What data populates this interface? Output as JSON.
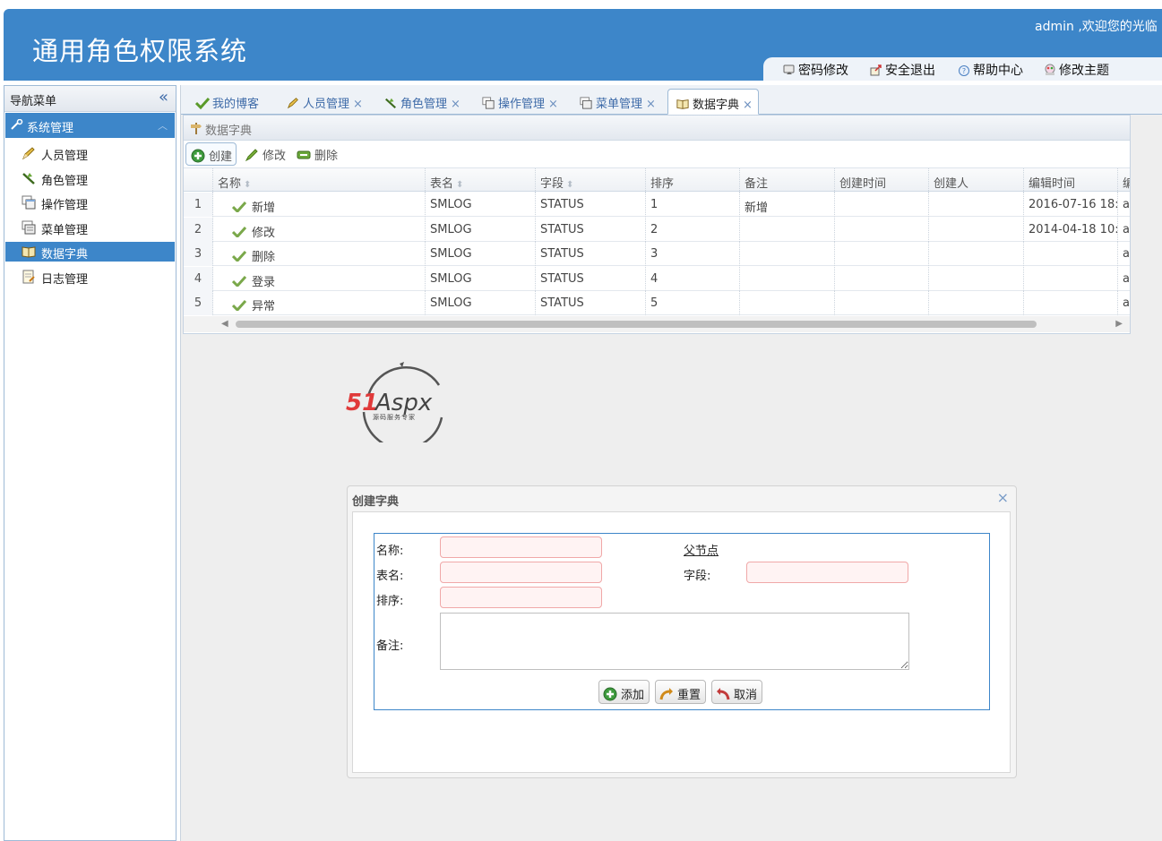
{
  "header": {
    "title": "通用角色权限系统",
    "welcome": "admin ,欢迎您的光临",
    "links": [
      "密码修改",
      "安全退出",
      "帮助中心",
      "修改主题"
    ]
  },
  "sidebar": {
    "title": "导航菜单",
    "collapse": "«",
    "group": "系统管理",
    "items": [
      "人员管理",
      "角色管理",
      "操作管理",
      "菜单管理",
      "数据字典",
      "日志管理"
    ],
    "active_index": 4
  },
  "tabs": [
    {
      "label": "我的博客",
      "closable": false
    },
    {
      "label": "人员管理",
      "closable": true
    },
    {
      "label": "角色管理",
      "closable": true
    },
    {
      "label": "操作管理",
      "closable": true
    },
    {
      "label": "菜单管理",
      "closable": true
    },
    {
      "label": "数据字典",
      "closable": true,
      "active": true
    }
  ],
  "tab_close": "×",
  "panel": {
    "title": "数据字典",
    "toolbar": {
      "create": "创建",
      "edit": "修改",
      "delete": "删除"
    }
  },
  "grid": {
    "columns": [
      "名称",
      "表名",
      "字段",
      "排序",
      "备注",
      "创建时间",
      "创建人",
      "编辑时间",
      "编"
    ],
    "rows": [
      {
        "no": "1",
        "name": "新增",
        "table": "SMLOG",
        "field": "STATUS",
        "order": "1",
        "remark": "新增",
        "created": "",
        "creator": "",
        "edited": "2016-07-16 18:",
        "last": "a"
      },
      {
        "no": "2",
        "name": "修改",
        "table": "SMLOG",
        "field": "STATUS",
        "order": "2",
        "remark": "",
        "created": "",
        "creator": "",
        "edited": "2014-04-18 10:",
        "last": "a"
      },
      {
        "no": "3",
        "name": "删除",
        "table": "SMLOG",
        "field": "STATUS",
        "order": "3",
        "remark": "",
        "created": "",
        "creator": "",
        "edited": "",
        "last": "a"
      },
      {
        "no": "4",
        "name": "登录",
        "table": "SMLOG",
        "field": "STATUS",
        "order": "4",
        "remark": "",
        "created": "",
        "creator": "",
        "edited": "",
        "last": "a"
      },
      {
        "no": "5",
        "name": "异常",
        "table": "SMLOG",
        "field": "STATUS",
        "order": "5",
        "remark": "",
        "created": "",
        "creator": "",
        "edited": "",
        "last": "a"
      }
    ]
  },
  "logo": {
    "brand_a": "51",
    "brand_b": "Aspx",
    "tagline": "源码服务专家"
  },
  "dialog": {
    "title": "创建字典",
    "close": "×",
    "labels": {
      "name": "名称:",
      "parent": "父节点",
      "table": "表名:",
      "field": "字段:",
      "order": "排序:",
      "remark": "备注:"
    },
    "buttons": {
      "add": "添加",
      "reset": "重置",
      "cancel": "取消"
    }
  },
  "colors": {
    "accent": "#3d86c9",
    "invalid_border": "#f0a8a8"
  }
}
